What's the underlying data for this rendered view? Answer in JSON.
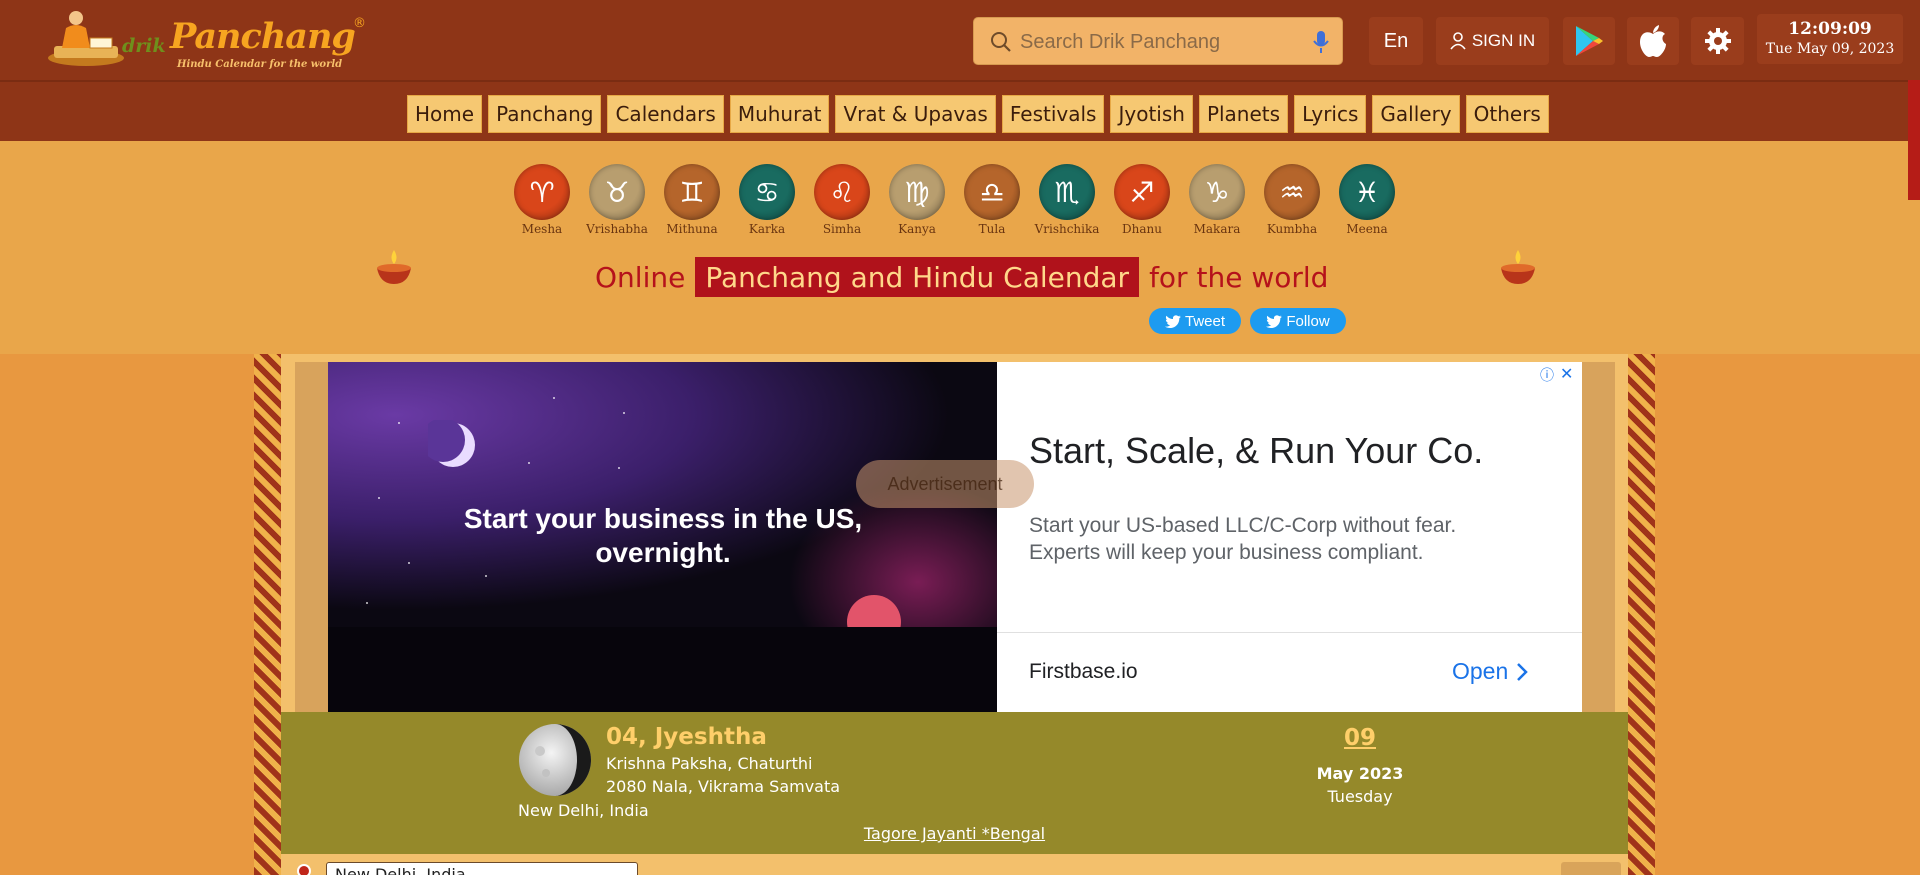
{
  "brand": {
    "logo_drik": "drik",
    "logo_panchang": "Panchang",
    "logo_reg": "®",
    "tagline": "Hindu Calendar for the world"
  },
  "header": {
    "search_placeholder": "Search Drik Panchang",
    "language": "En",
    "sign_in": "SIGN IN",
    "clock_time": "12:09:09",
    "clock_date": "Tue May 09, 2023"
  },
  "nav": [
    "Home",
    "Panchang",
    "Calendars",
    "Muhurat",
    "Vrat & Upavas",
    "Festivals",
    "Jyotish",
    "Planets",
    "Lyrics",
    "Gallery",
    "Others"
  ],
  "zodiac": [
    {
      "name": "Mesha",
      "glyph": "♈",
      "color": "#d9461a"
    },
    {
      "name": "Vrishabha",
      "glyph": "♉",
      "color": "#b89e6f"
    },
    {
      "name": "Mithuna",
      "glyph": "♊",
      "color": "#b5652b"
    },
    {
      "name": "Karka",
      "glyph": "♋",
      "color": "#196b60"
    },
    {
      "name": "Simha",
      "glyph": "♌",
      "color": "#d9461a"
    },
    {
      "name": "Kanya",
      "glyph": "♍",
      "color": "#b89e6f"
    },
    {
      "name": "Tula",
      "glyph": "♎",
      "color": "#b5652b"
    },
    {
      "name": "Vrishchika",
      "glyph": "♏",
      "color": "#196b60"
    },
    {
      "name": "Dhanu",
      "glyph": "♐",
      "color": "#d9461a"
    },
    {
      "name": "Makara",
      "glyph": "♑",
      "color": "#b89e6f"
    },
    {
      "name": "Kumbha",
      "glyph": "♒",
      "color": "#b5652b"
    },
    {
      "name": "Meena",
      "glyph": "♓",
      "color": "#196b60"
    }
  ],
  "hero": {
    "online": "Online",
    "highlight": "Panchang and Hindu Calendar",
    "for_world": "for the world",
    "tweet": "Tweet",
    "follow": "Follow"
  },
  "ad": {
    "label": "Advertisement",
    "image_headline": "Start your business in the US, overnight.",
    "title": "Start, Scale, & Run Your Co.",
    "description": "Start your US-based LLC/C-Corp without fear. Experts will keep your business compliant.",
    "brand": "Firstbase.io",
    "cta": "Open"
  },
  "today": {
    "lunar_date": "04, Jyeshtha",
    "paksha": "Krishna Paksha, Chaturthi",
    "samvata": "2080 Nala, Vikrama Samvata",
    "location": "New Delhi, India",
    "day": "09",
    "month_year": "May 2023",
    "weekday": "Tuesday",
    "festival": "Tagore Jayanti *Bengal"
  },
  "location_search": {
    "value": "New Delhi, India"
  },
  "colors": {
    "header_bg": "#8e3517",
    "hero_bg": "#e9a64a",
    "accent_red": "#b0121b",
    "datebar_bg": "#95892a",
    "twitter": "#1d9bf0"
  }
}
